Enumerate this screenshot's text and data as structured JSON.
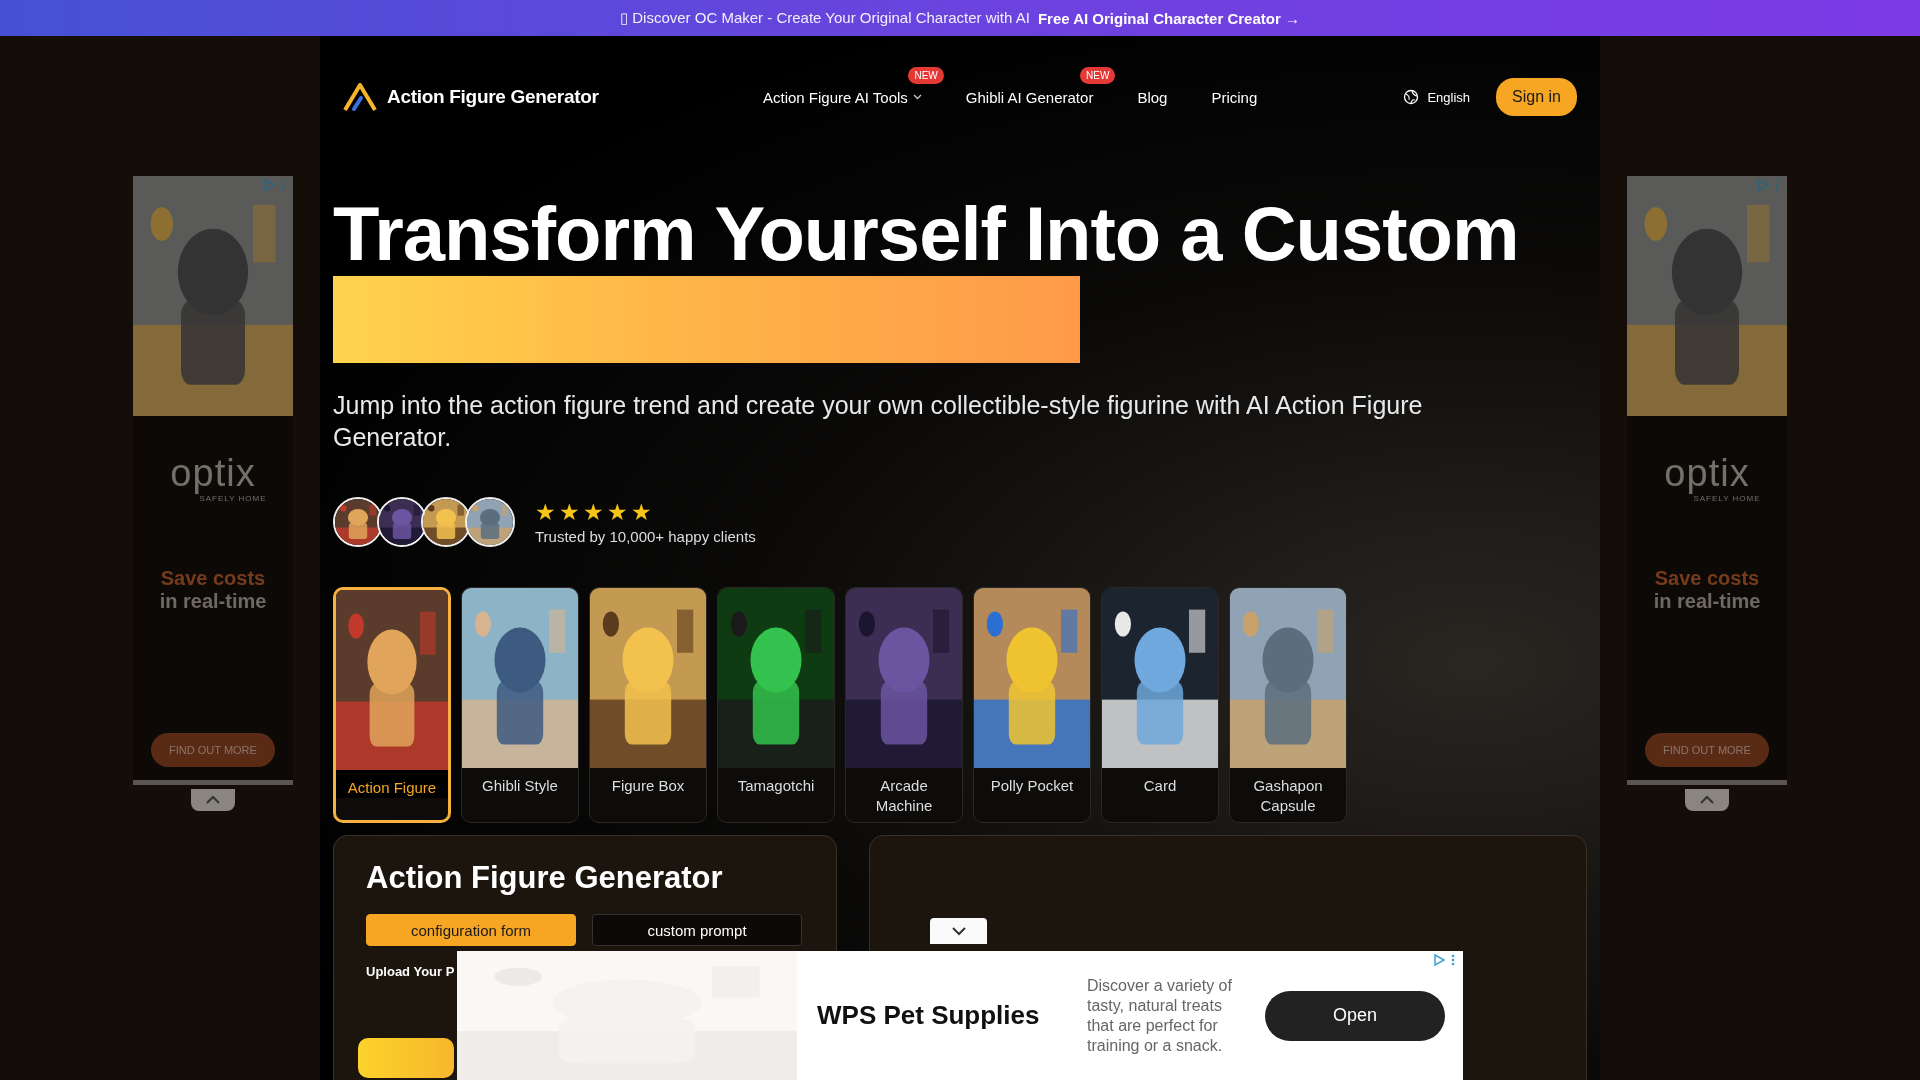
{
  "banner": {
    "text": "▯ Discover OC Maker - Create Your Original Character with AI",
    "link": "Free AI Original Character Creator →"
  },
  "nav": {
    "logo": "Action Figure Generator",
    "items": [
      {
        "label": "Action Figure AI Tools",
        "dropdown": true,
        "badge": "NEW"
      },
      {
        "label": "Ghibli AI Generator",
        "dropdown": false,
        "badge": "NEW"
      },
      {
        "label": "Blog",
        "dropdown": false
      },
      {
        "label": "Pricing",
        "dropdown": false
      }
    ],
    "language": "English",
    "sign_in": "Sign in"
  },
  "hero": {
    "title": "Transform Yourself Into a Custom",
    "subtitle": "Jump into the action figure trend and create your own collectible-style figurine with AI Action Figure Generator.",
    "rating": {
      "stars": 5,
      "text": "Trusted by 10,000+ happy clients"
    }
  },
  "styles": [
    {
      "label": "Action Figure",
      "selected": true
    },
    {
      "label": "Ghibli Style",
      "selected": false
    },
    {
      "label": "Figure Box",
      "selected": false
    },
    {
      "label": "Tamagotchi",
      "selected": false
    },
    {
      "label": "Arcade Machine",
      "selected": false
    },
    {
      "label": "Polly Pocket",
      "selected": false
    },
    {
      "label": "Card",
      "selected": false
    },
    {
      "label": "Gashapon Capsule",
      "selected": false
    }
  ],
  "generator": {
    "title": "Action Figure Generator",
    "tabs": [
      {
        "label": "configuration form",
        "selected": true
      },
      {
        "label": "custom prompt",
        "selected": false
      }
    ],
    "upload_label": "Upload Your P"
  },
  "side_ads": [
    {
      "logo": "optix",
      "tagline": "SAFELY HOME",
      "headline_1": "Save costs",
      "headline_2": "in real-time",
      "cta": "FIND OUT MORE"
    },
    {
      "logo": "optix",
      "tagline": "SAFELY HOME",
      "headline_1": "Save costs",
      "headline_2": "in real-time",
      "cta": "FIND OUT MORE"
    }
  ],
  "bottom_ad": {
    "title": "WPS Pet Supplies",
    "body": "Discover a variety of tasty, natural treats that are perfect for training or a snack.",
    "cta": "Open"
  }
}
